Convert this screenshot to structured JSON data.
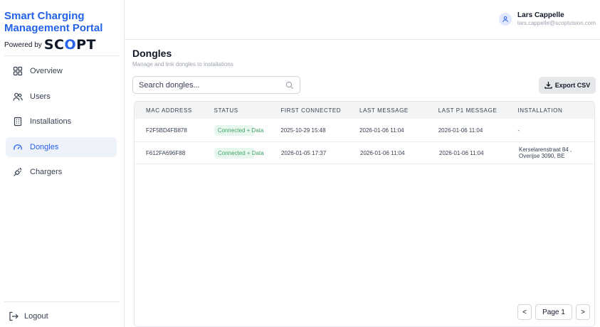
{
  "brand": {
    "title": "Smart Charging Management Portal",
    "powered_by": "Powered by",
    "logo_left": "SC",
    "logo_mid": "O",
    "logo_right": "PT"
  },
  "sidebar": {
    "items": [
      {
        "label": "Overview",
        "icon": "grid-icon",
        "active": false
      },
      {
        "label": "Users",
        "icon": "users-icon",
        "active": false
      },
      {
        "label": "Installations",
        "icon": "building-icon",
        "active": false
      },
      {
        "label": "Dongles",
        "icon": "gauge-icon",
        "active": true
      },
      {
        "label": "Chargers",
        "icon": "plug-icon",
        "active": false
      }
    ],
    "logout_label": "Logout"
  },
  "user": {
    "name": "Lars Cappelle",
    "email": "lars.cappelle@scoptvision.com"
  },
  "page": {
    "title": "Dongles",
    "subtitle": "Manage and link dongles to installations"
  },
  "search": {
    "placeholder": "Search dongles..."
  },
  "toolbar": {
    "export_label": "Export CSV"
  },
  "table": {
    "headers": [
      "MAC ADDRESS",
      "STATUS",
      "FIRST CONNECTED",
      "LAST MESSAGE",
      "LAST P1 MESSAGE",
      "INSTALLATION"
    ],
    "rows": [
      {
        "mac": "F2F5BD4FB878",
        "status": "Connected + Data",
        "first_connected": "2025-10-29 15:48",
        "last_message": "2026-01-06 11:04",
        "last_p1_message": "2026-01-06 11:04",
        "installation": "-"
      },
      {
        "mac": "F612FA696F88",
        "status": "Connected + Data",
        "first_connected": "2026-01-05 17:37",
        "last_message": "2026-01-06 11:04",
        "last_p1_message": "2026-01-06 11:04",
        "installation": "Kerselarenstraat 84 , Overijse 3090, BE"
      }
    ]
  },
  "pagination": {
    "label": "Page 1",
    "prev": "<",
    "next": ">"
  },
  "colors": {
    "accent": "#2563eb",
    "badge_bg": "#e8f7ee",
    "badge_text": "#3fa36a"
  }
}
